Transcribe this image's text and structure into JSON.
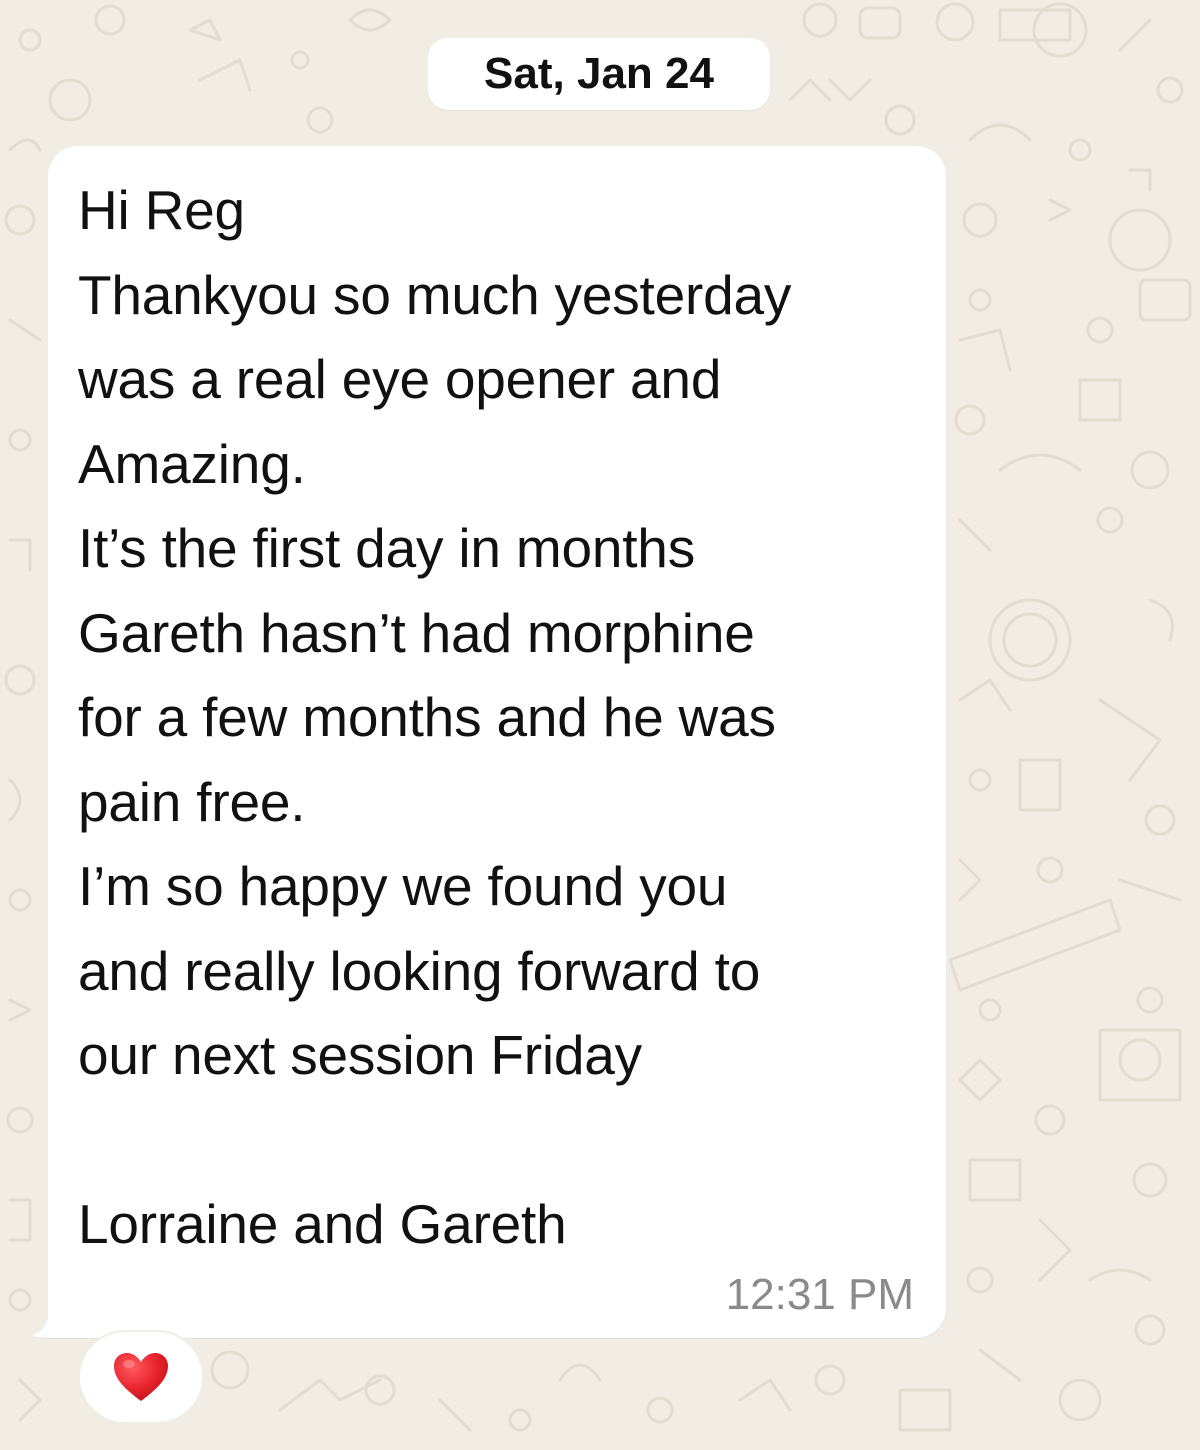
{
  "chat": {
    "date_separator": "Sat, Jan 24",
    "message": {
      "text": "Hi Reg\nThankyou so much yesterday\nwas a real eye opener and\nAmazing.\nIt’s the first day in months\nGareth hasn’t had morphine\nfor a few months and he was\npain free.\nI’m so happy we found you\nand really looking forward to\nour next session Friday\n\nLorraine and Gareth",
      "time": "12:31 PM",
      "direction": "incoming",
      "reaction": {
        "icon": "red-heart-icon",
        "color": "#e8242d"
      }
    }
  },
  "colors": {
    "background": "#f1ede5",
    "bubble": "#ffffff",
    "timestamp": "#8a8a8a",
    "doodle": "#e4ddd1"
  }
}
